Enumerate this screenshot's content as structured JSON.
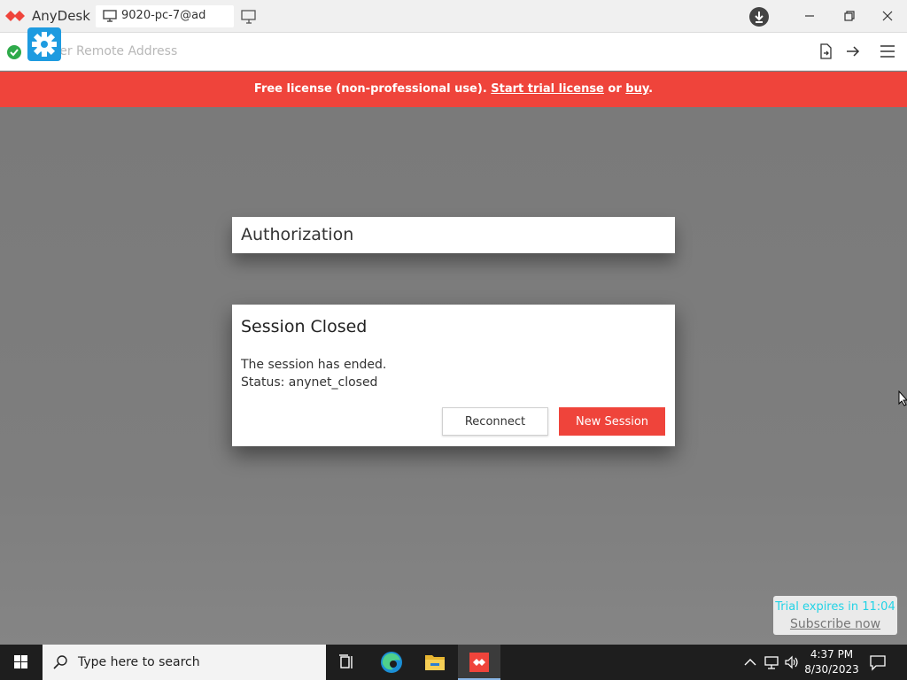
{
  "app": {
    "name": "AnyDesk"
  },
  "tab": {
    "label": "9020-pc-7@ad"
  },
  "address": {
    "placeholder": "Enter Remote Address",
    "value": ""
  },
  "banner": {
    "prefix": "Free license (non-professional use). ",
    "trial_link": "Start trial license",
    "or": " or ",
    "buy_link": "buy",
    "suffix": "."
  },
  "auth": {
    "title": "Authorization"
  },
  "dialog": {
    "title": "Session Closed",
    "message": "The session has ended.",
    "status": "Status: anynet_closed",
    "reconnect": "Reconnect",
    "new_session": "New Session"
  },
  "trial": {
    "expires": "Trial expires in 11:04",
    "subscribe": "Subscribe now"
  },
  "taskbar": {
    "search_placeholder": "Type here to search",
    "time": "4:37 PM",
    "date": "8/30/2023"
  },
  "colors": {
    "accent": "#ef443b",
    "status_ok": "#2eaa4a",
    "gear": "#1e9be0",
    "trial_text": "#22d3e6"
  },
  "icons": [
    "anydesk-logo",
    "monitor-icon",
    "new-tab-icon",
    "download-icon",
    "minimize-icon",
    "restore-icon",
    "close-icon",
    "status-ok-icon",
    "settings-gear-icon",
    "file-transfer-icon",
    "connect-arrow-icon",
    "menu-icon",
    "windows-start-icon",
    "search-icon",
    "task-view-icon",
    "edge-icon",
    "file-explorer-icon",
    "chevron-up-icon",
    "network-icon",
    "volume-icon",
    "notification-icon",
    "mouse-cursor-icon"
  ]
}
